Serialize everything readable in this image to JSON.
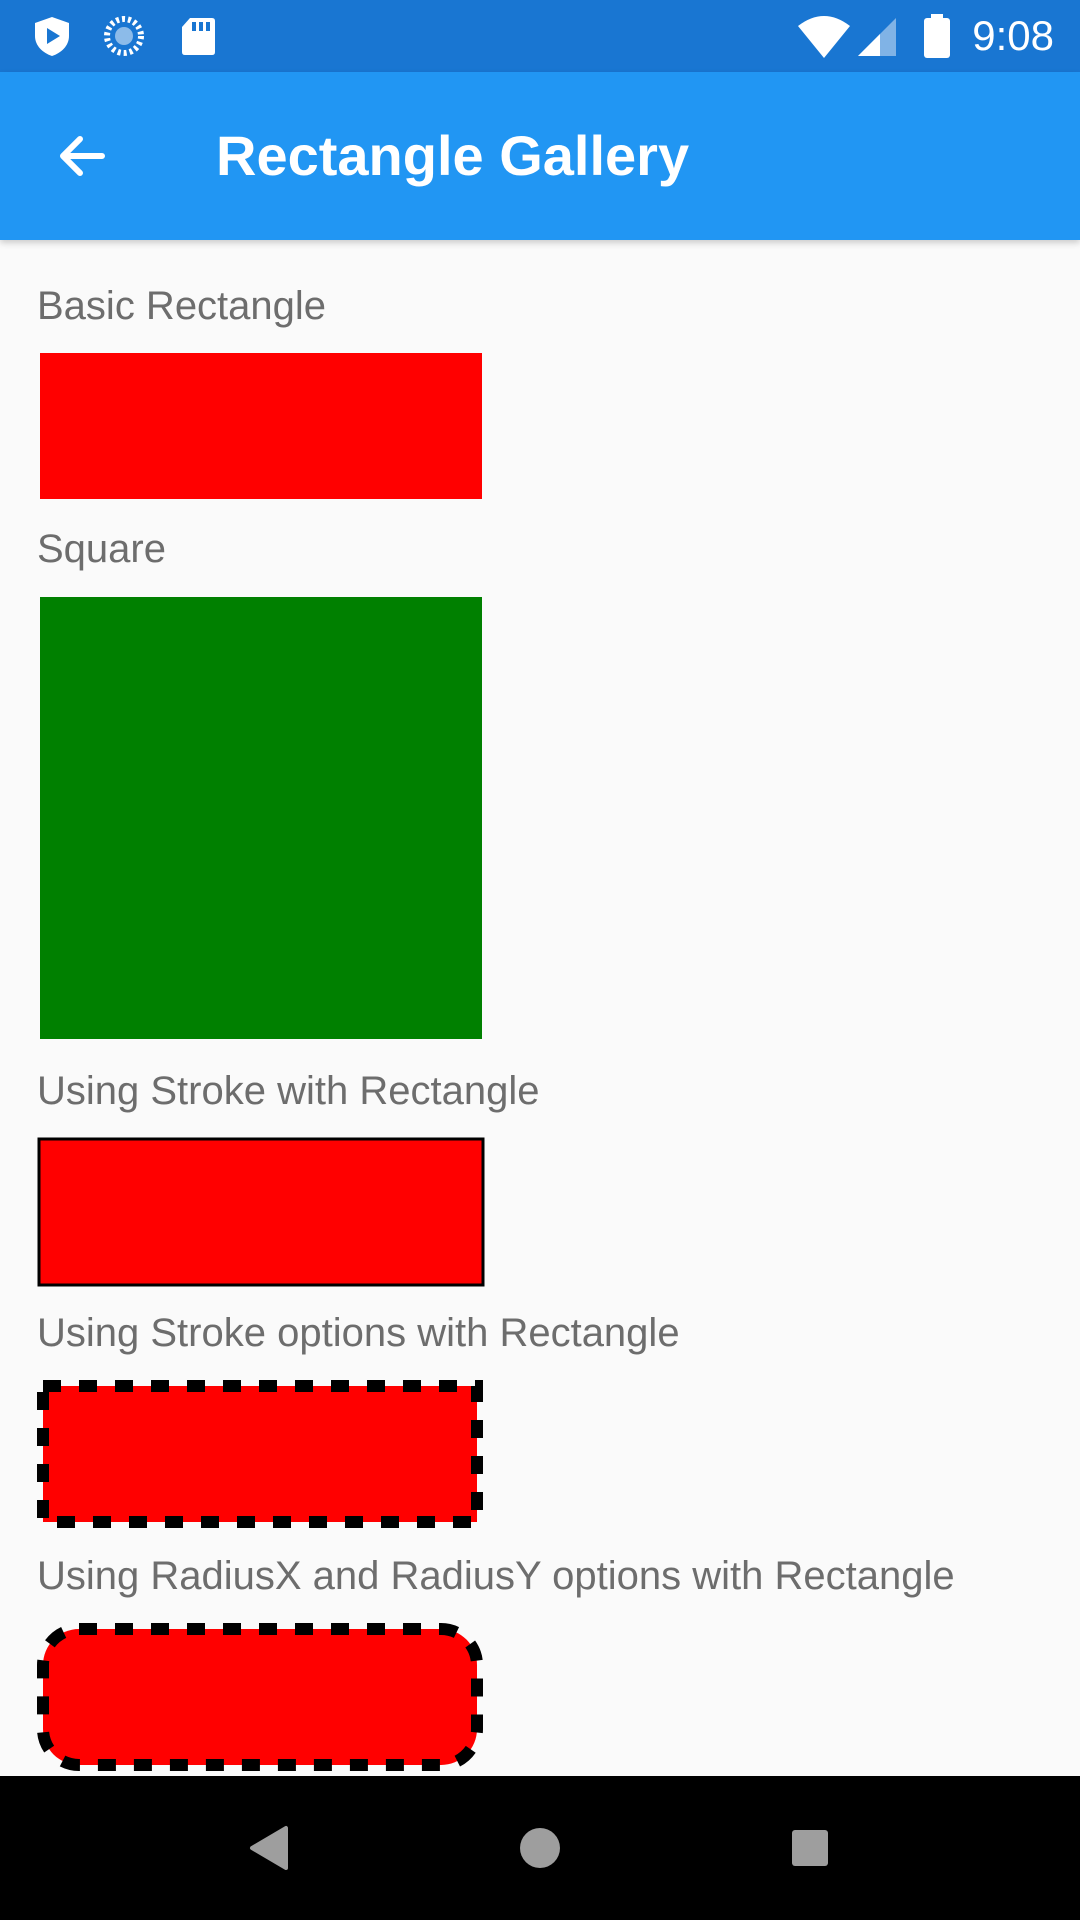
{
  "status_bar": {
    "time": "9:08",
    "icons": [
      "play-protect-icon",
      "sync-icon",
      "sd-card-icon",
      "wifi-icon",
      "cell-signal-icon",
      "battery-icon"
    ]
  },
  "app_bar": {
    "title": "Rectangle Gallery",
    "back_icon": "arrow-back-icon"
  },
  "sections": [
    {
      "label": "Basic Rectangle",
      "fill": "#ff0000",
      "stroke": "none"
    },
    {
      "label": "Square",
      "fill": "#008000",
      "stroke": "none"
    },
    {
      "label": "Using Stroke with Rectangle",
      "fill": "#ff0000",
      "stroke": "#000000"
    },
    {
      "label": "Using Stroke options with Rectangle",
      "fill": "#ff0000",
      "stroke": "#000000",
      "stroke_style": "dashed"
    },
    {
      "label": "Using RadiusX and RadiusY options with Rectangle",
      "fill": "#ff0000",
      "stroke": "#000000",
      "stroke_style": "dashed",
      "rounded": true
    }
  ],
  "nav_bar": {
    "buttons": [
      "back-triangle-icon",
      "home-circle-icon",
      "recents-square-icon"
    ]
  },
  "colors": {
    "status_bar": "#1976d2",
    "app_bar": "#2196f3",
    "background": "#fafafa",
    "label_text": "#6d6d6d"
  }
}
